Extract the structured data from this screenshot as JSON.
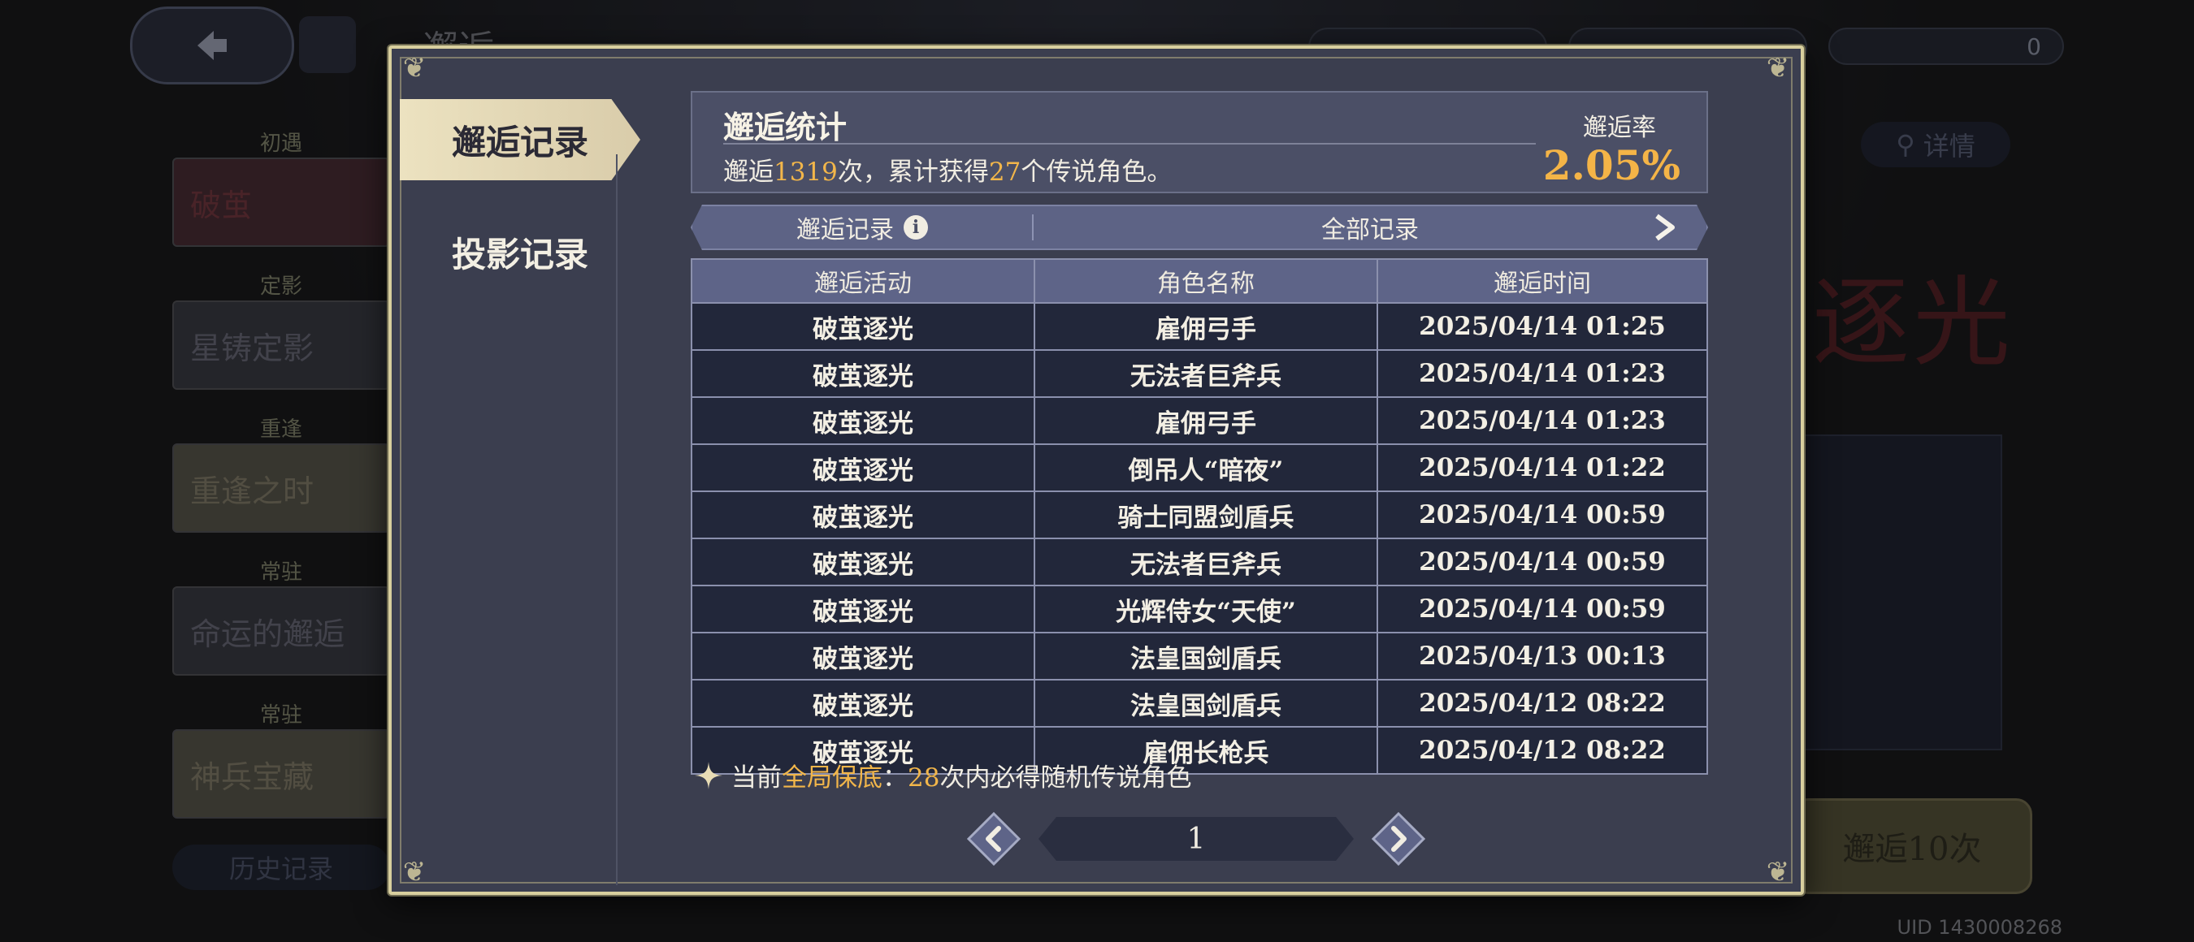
{
  "background": {
    "screen_title": "邂逅",
    "banners": [
      {
        "tag": "初遇",
        "name": "破茧"
      },
      {
        "tag": "定影",
        "name": "星铸定影"
      },
      {
        "tag": "重逢",
        "name": "重逢之时"
      },
      {
        "tag": "常驻",
        "name": "命运的邂逅"
      },
      {
        "tag": "常驻",
        "name": "神兵宝藏"
      }
    ],
    "history_button": "历史记录",
    "details_button": "详情",
    "featured_title": "逐光",
    "pull_button": "邂逅10次",
    "currency_value": "0",
    "uid": "UID 1430008268"
  },
  "tabs": {
    "encounter_records": "邂逅记录",
    "projection_records": "投影记录"
  },
  "stats": {
    "title": "邂逅统计",
    "desc_prefix": "邂逅",
    "total_pulls": "1319",
    "desc_mid": "次，累计获得",
    "legendary_count": "27",
    "desc_suffix": "个传说角色。",
    "rate_label": "邂逅率",
    "rate_value": "2.05%"
  },
  "filter": {
    "left_label": "邂逅记录",
    "right_label": "全部记录"
  },
  "table": {
    "headers": [
      "邂逅活动",
      "角色名称",
      "邂逅时间"
    ],
    "rows": [
      [
        "破茧逐光",
        "雇佣弓手",
        "2025/04/14 01:25"
      ],
      [
        "破茧逐光",
        "无法者巨斧兵",
        "2025/04/14 01:23"
      ],
      [
        "破茧逐光",
        "雇佣弓手",
        "2025/04/14 01:23"
      ],
      [
        "破茧逐光",
        "倒吊人“暗夜”",
        "2025/04/14 01:22"
      ],
      [
        "破茧逐光",
        "骑士同盟剑盾兵",
        "2025/04/14 00:59"
      ],
      [
        "破茧逐光",
        "无法者巨斧兵",
        "2025/04/14 00:59"
      ],
      [
        "破茧逐光",
        "光辉侍女“天使”",
        "2025/04/14 00:59"
      ],
      [
        "破茧逐光",
        "法皇国剑盾兵",
        "2025/04/13 00:13"
      ],
      [
        "破茧逐光",
        "法皇国剑盾兵",
        "2025/04/12 08:22"
      ],
      [
        "破茧逐光",
        "雇佣长枪兵",
        "2025/04/12 08:22"
      ]
    ]
  },
  "pity": {
    "prefix": "当前",
    "highlight": "全局保底",
    "colon": "：",
    "count": "28",
    "suffix": "次内必得随机传说角色"
  },
  "pagination": {
    "current_page": "1"
  },
  "colors": {
    "accent_gold": "#f2b64a",
    "frame_gold": "#d8cf9e",
    "panel": "#3b3e4f",
    "row_dark": "#22273a"
  }
}
